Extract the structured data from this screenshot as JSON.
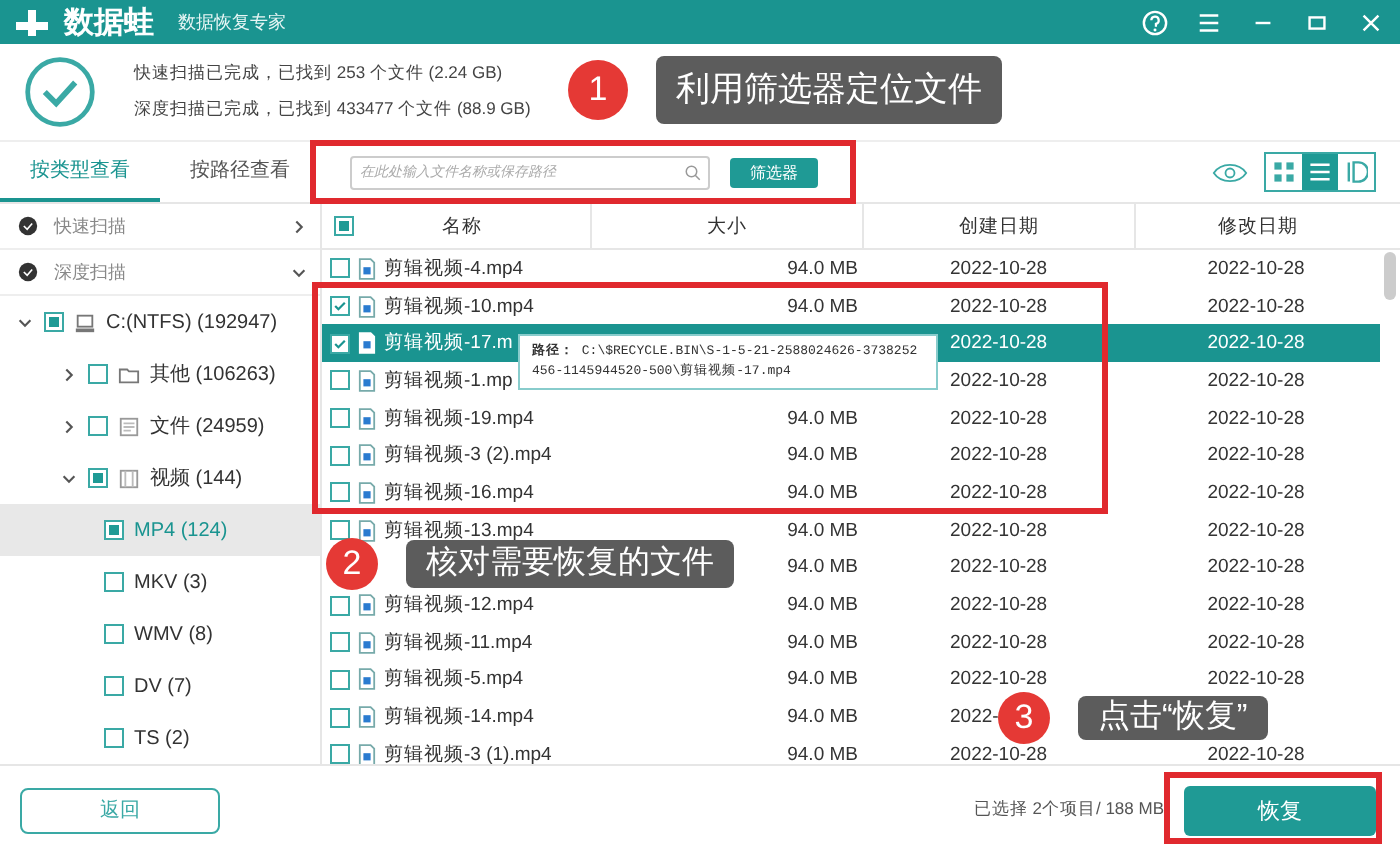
{
  "app": {
    "name": "数据蛙",
    "subtitle": "数据恢复专家"
  },
  "scan_summary": [
    "快速扫描已完成，已找到 253 个文件 (2.24 GB)",
    "深度扫描已完成，已找到 433477 个文件 (88.9 GB)"
  ],
  "view_tabs": [
    {
      "label": "按类型查看",
      "selected": true
    },
    {
      "label": "按路径查看",
      "selected": false
    }
  ],
  "search": {
    "placeholder": "在此处输入文件名称或保存路径"
  },
  "filter_button": "筛选器",
  "view_modes": [
    {
      "kind": "grid",
      "selected": false
    },
    {
      "kind": "list",
      "selected": true
    },
    {
      "kind": "detail",
      "selected": false
    }
  ],
  "scan_sections": [
    {
      "label": "快速扫描",
      "expanded": false
    },
    {
      "label": "深度扫描",
      "expanded": true
    }
  ],
  "tree": [
    {
      "label": "C:(NTFS) (192947)",
      "kind": "drive",
      "expanded": true,
      "partial": true,
      "selected": false,
      "children": [
        {
          "label": "其他 (106263)",
          "kind": "folder",
          "expanded": false,
          "partial": false,
          "selected": false
        },
        {
          "label": "文件 (24959)",
          "kind": "document",
          "expanded": false,
          "partial": false,
          "selected": false
        },
        {
          "label": "视频 (144)",
          "kind": "video",
          "expanded": true,
          "partial": true,
          "selected": false,
          "children": [
            {
              "label": "MP4 (124)",
              "partial": true,
              "selected": true
            },
            {
              "label": "MKV (3)",
              "partial": false,
              "selected": false
            },
            {
              "label": "WMV (8)",
              "partial": false,
              "selected": false
            },
            {
              "label": "DV (7)",
              "partial": false,
              "selected": false
            },
            {
              "label": "TS (2)",
              "partial": false,
              "selected": false
            }
          ]
        }
      ]
    }
  ],
  "table": {
    "all_partial": true,
    "columns": [
      "名称",
      "大小",
      "创建日期",
      "修改日期"
    ],
    "rows": [
      {
        "name": "剪辑视频-4.mp4",
        "size": "94.0 MB",
        "created": "2022-10-28",
        "modified": "2022-10-28",
        "checked": false,
        "selected": false
      },
      {
        "name": "剪辑视频-10.mp4",
        "size": "94.0 MB",
        "created": "2022-10-28",
        "modified": "2022-10-28",
        "checked": true,
        "selected": false
      },
      {
        "name": "剪辑视频-17.m",
        "created": "2022-10-28",
        "modified": "2022-10-28",
        "checked": true,
        "selected": true
      },
      {
        "name": "剪辑视频-1.mp",
        "created": "2022-10-28",
        "modified": "2022-10-28",
        "checked": false,
        "selected": false
      },
      {
        "name": "剪辑视频-19.mp4",
        "size": "94.0 MB",
        "created": "2022-10-28",
        "modified": "2022-10-28",
        "checked": false,
        "selected": false
      },
      {
        "name": "剪辑视频-3 (2).mp4",
        "size": "94.0 MB",
        "created": "2022-10-28",
        "modified": "2022-10-28",
        "checked": false,
        "selected": false
      },
      {
        "name": "剪辑视频-16.mp4",
        "size": "94.0 MB",
        "created": "2022-10-28",
        "modified": "2022-10-28",
        "checked": false,
        "selected": false
      },
      {
        "name": "剪辑视频-13.mp4",
        "size": "94.0 MB",
        "created": "2022-10-28",
        "modified": "2022-10-28",
        "checked": false,
        "selected": false
      },
      {
        "size": "94.0 MB",
        "created": "2022-10-28",
        "modified": "2022-10-28",
        "selected": false
      },
      {
        "name": "剪辑视频-12.mp4",
        "size": "94.0 MB",
        "created": "2022-10-28",
        "modified": "2022-10-28",
        "checked": false,
        "selected": false
      },
      {
        "name": "剪辑视频-11.mp4",
        "size": "94.0 MB",
        "created": "2022-10-28",
        "modified": "2022-10-28",
        "checked": false,
        "selected": false
      },
      {
        "name": "剪辑视频-5.mp4",
        "size": "94.0 MB",
        "created": "2022-10-28",
        "modified": "2022-10-28",
        "checked": false,
        "selected": false
      },
      {
        "name": "剪辑视频-14.mp4",
        "size": "94.0 MB",
        "created": "2022-",
        "checked": false,
        "selected": false
      },
      {
        "name": "剪辑视频-3 (1).mp4",
        "size": "94.0 MB",
        "created": "2022-10-28",
        "modified": "2022-10-28",
        "checked": false,
        "selected": false
      }
    ]
  },
  "path_tooltip": {
    "label": "路径：",
    "path": "C:\\$RECYCLE.BIN\\S-1-5-21-2588024626-3738252456-1145944520-500\\剪辑视频-17.mp4"
  },
  "back_button": "返回",
  "selection_status": "已选择 2个项目/ 188 MB",
  "recover_button": "恢复",
  "callouts": [
    {
      "number": "1",
      "text": "利用筛选器定位文件"
    },
    {
      "number": "2",
      "text": "核对需要恢复的文件"
    },
    {
      "number": "3",
      "text": "点击“恢复”"
    }
  ]
}
